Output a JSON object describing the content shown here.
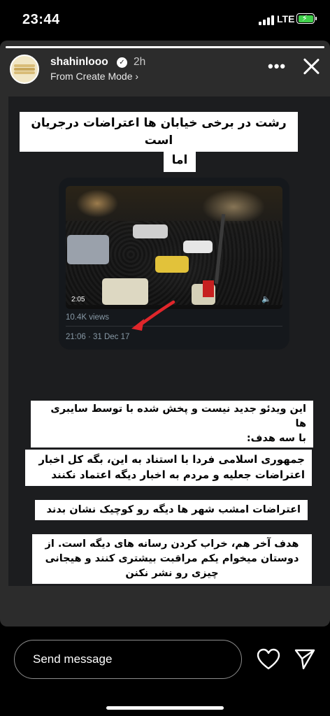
{
  "status_bar": {
    "time": "23:44",
    "network": "LTE",
    "battery_color": "#3fd04a"
  },
  "story": {
    "progress": 1.0,
    "username": "shahinlooo",
    "time_ago": "2h",
    "subtitle": "From Create Mode ›",
    "more_icon": "more-dots-icon",
    "close_icon": "close-icon"
  },
  "content": {
    "headline": "رشت در برخی خیابان ها اعتراضات درجریان است",
    "but": "اما",
    "tweet": {
      "video_duration": "2:05",
      "views": "10.4K views",
      "date": "21:06 · 31 Dec 17",
      "arrow_color": "#e0262b"
    },
    "para1_line1": "این ویدئو جدید نیست و پخش شده با توسط سایبری ها",
    "para1_line2": "با سه هدف:",
    "para2_line1": "جمهوری اسلامی فردا با استناد به این، بگه کل اخبار",
    "para2_line2": "اعتراضات جعلیه و مردم به اخبار دیگه اعتماد نکنند",
    "para3": "اعتراضات امشب شهر ها دیگه رو کوچیک نشان بدند",
    "para4_line1": "هدف آخر هم، خراب کردن رسانه های دیگه است. از",
    "para4_line2": "دوستان میخوام یکم مراقبت بیشتری کنند و هیجانی",
    "para4_line3": "چیزی رو نشر نکنن"
  },
  "bottom_bar": {
    "message_placeholder": "Send message",
    "like_icon": "heart-icon",
    "send_icon": "send-icon"
  }
}
